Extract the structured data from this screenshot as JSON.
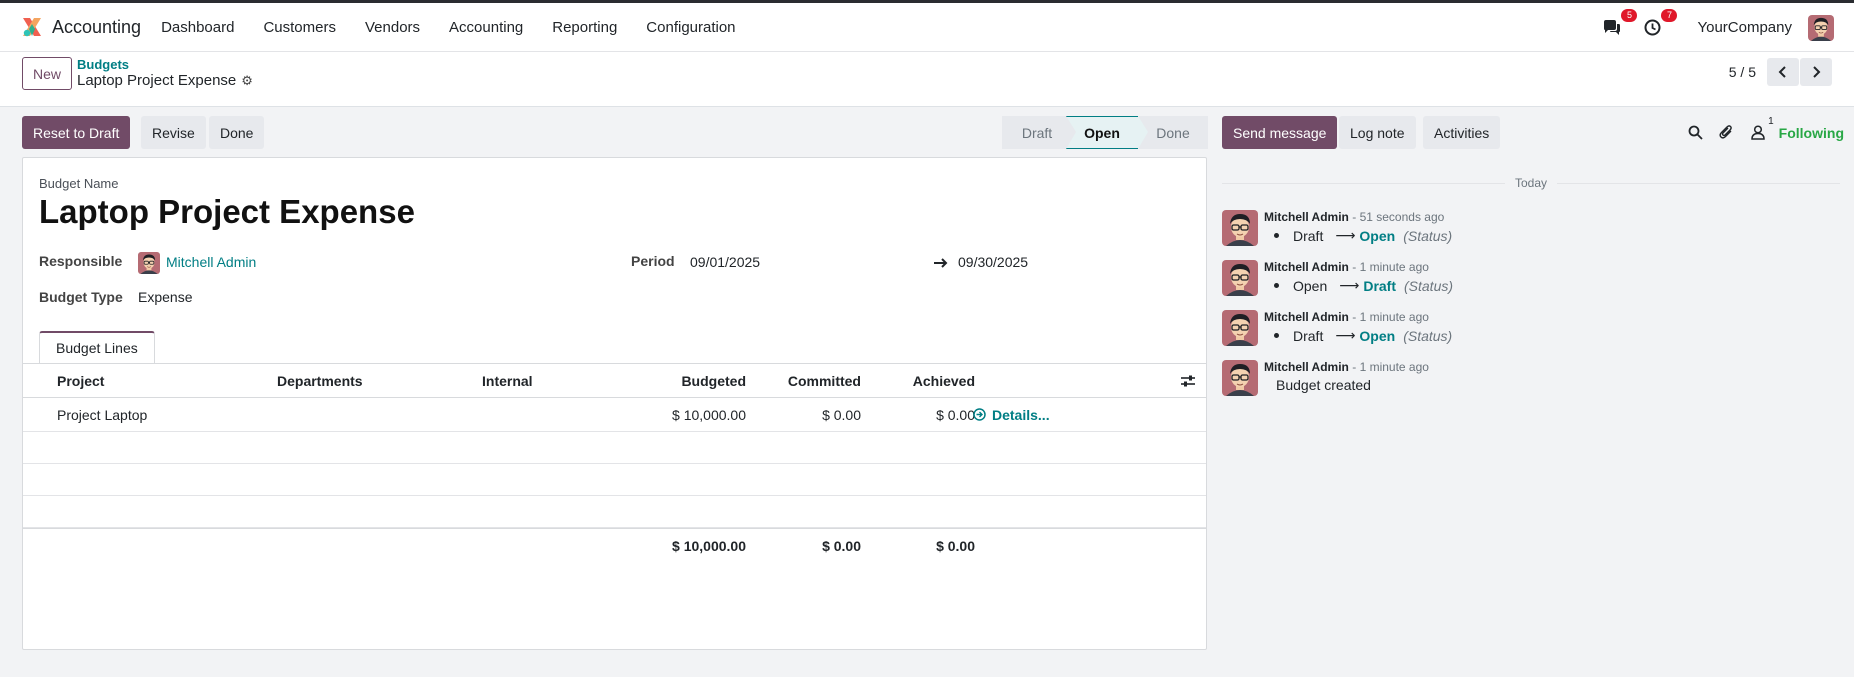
{
  "app": {
    "name": "Accounting"
  },
  "menu": [
    "Dashboard",
    "Customers",
    "Vendors",
    "Accounting",
    "Reporting",
    "Configuration"
  ],
  "systray": {
    "messages_count": "5",
    "activities_count": "7",
    "company": "YourCompany"
  },
  "control_panel": {
    "new_label": "New",
    "breadcrumb_parent": "Budgets",
    "breadcrumb_current": "Laptop Project Expense",
    "pager": "5 / 5"
  },
  "actions": {
    "reset": "Reset to Draft",
    "revise": "Revise",
    "done": "Done"
  },
  "stages": {
    "draft": "Draft",
    "open": "Open",
    "done": "Done",
    "current": "Open"
  },
  "form": {
    "name_label": "Budget Name",
    "name": "Laptop Project Expense",
    "responsible_label": "Responsible",
    "responsible": "Mitchell Admin",
    "period_label": "Period",
    "period_start": "09/01/2025",
    "period_end": "09/30/2025",
    "type_label": "Budget Type",
    "type": "Expense",
    "tab": "Budget Lines"
  },
  "lines": {
    "headers": [
      "Project",
      "Departments",
      "Internal",
      "Budgeted",
      "Committed",
      "Achieved"
    ],
    "rows": [
      {
        "project": "Project Laptop",
        "departments": "",
        "internal": "",
        "budgeted": "$ 10,000.00",
        "committed": "$ 0.00",
        "achieved": "$ 0.00",
        "details": "Details..."
      }
    ],
    "totals": {
      "budgeted": "$ 10,000.00",
      "committed": "$ 0.00",
      "achieved": "$ 0.00"
    }
  },
  "chatter": {
    "send_message": "Send message",
    "log_note": "Log note",
    "activities": "Activities",
    "followers_count": "1",
    "following": "Following",
    "today": "Today",
    "messages": [
      {
        "author": "Mitchell Admin",
        "time": "- 51 seconds ago",
        "old": "Draft",
        "new": "Open",
        "field": "(Status)"
      },
      {
        "author": "Mitchell Admin",
        "time": "- 1 minute ago",
        "old": "Open",
        "new": "Draft",
        "field": "(Status)"
      },
      {
        "author": "Mitchell Admin",
        "time": "- 1 minute ago",
        "old": "Draft",
        "new": "Open",
        "field": "(Status)"
      },
      {
        "author": "Mitchell Admin",
        "time": "- 1 minute ago",
        "body": "Budget created"
      }
    ]
  },
  "colors": {
    "brand": "#714b67",
    "link": "#017e84",
    "success": "#28a745",
    "badge": "#e0182a"
  }
}
